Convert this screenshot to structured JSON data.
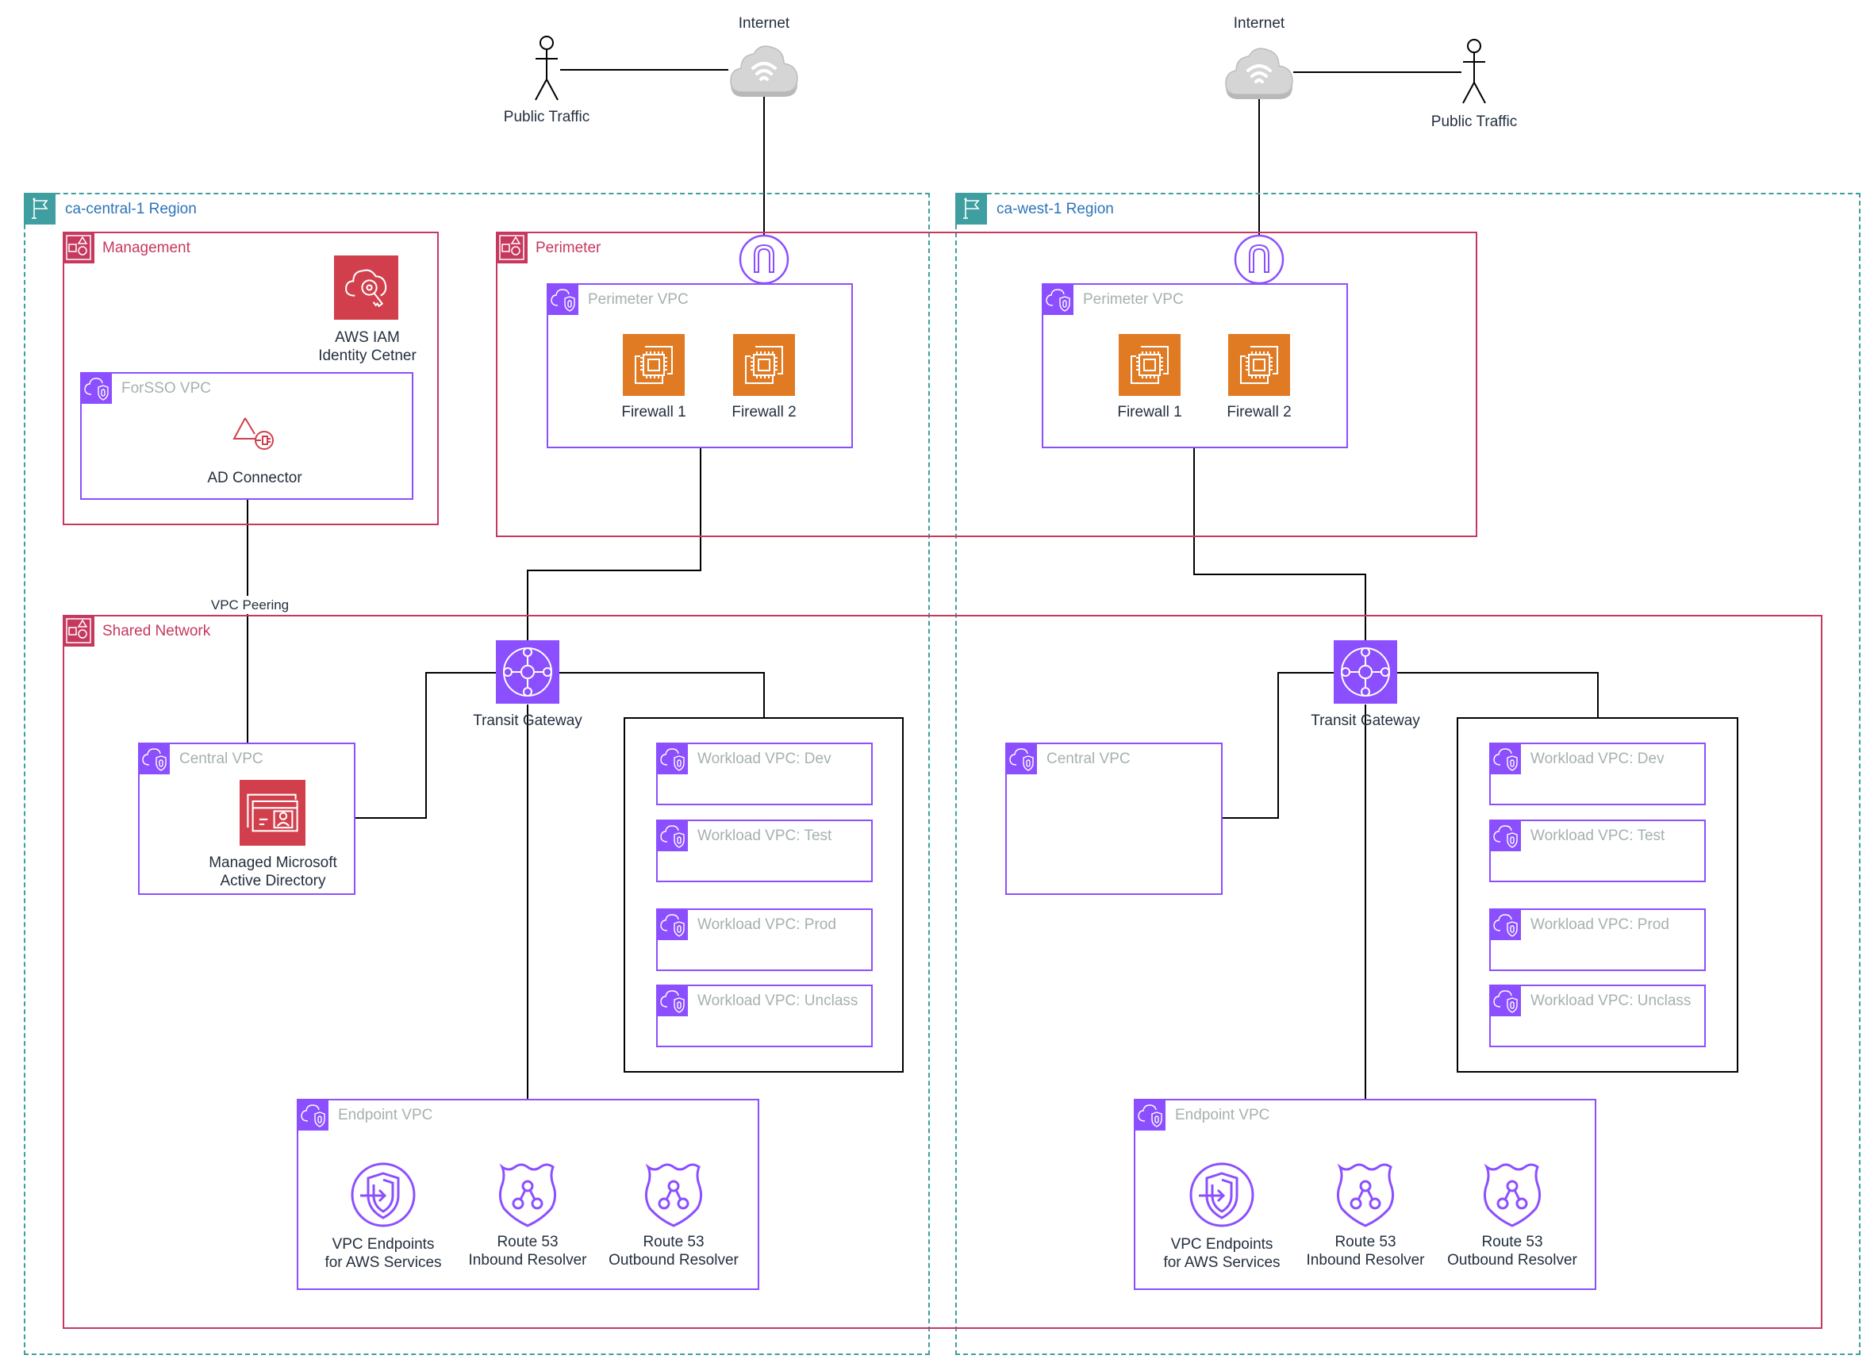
{
  "internet": [
    {
      "label": "Internet",
      "public_label": "Public Traffic"
    },
    {
      "label": "Internet",
      "public_label": "Public Traffic"
    }
  ],
  "regions": [
    {
      "label": "ca-central-1 Region",
      "management": {
        "label": "Management",
        "iam": {
          "line1": "AWS IAM",
          "line2": "Identity Cetner"
        },
        "forsso_vpc": {
          "label": "ForSSO VPC",
          "ad_connector": "AD Connector"
        }
      },
      "perimeter": {
        "label": "Perimeter",
        "vpc_label": "Perimeter VPC",
        "firewalls": [
          "Firewall 1",
          "Firewall 2"
        ]
      },
      "vpc_peering": "VPC Peering",
      "shared_network": {
        "label": "Shared Network",
        "tgw": "Transit Gateway",
        "central_vpc": {
          "label": "Central VPC",
          "mad": {
            "line1": "Managed Microsoft",
            "line2": "Active Directory"
          }
        },
        "workload_vpcs": [
          "Workload VPC: Dev",
          "Workload VPC: Test",
          "Workload VPC: Prod",
          "Workload VPC: Unclass"
        ],
        "endpoint_vpc": {
          "label": "Endpoint VPC",
          "services": [
            {
              "line1": "VPC Endpoints",
              "line2": "for AWS Services",
              "icon": "vpc-endpoints-icon"
            },
            {
              "line1": "Route 53",
              "line2": "Inbound Resolver",
              "icon": "route53-resolver-icon"
            },
            {
              "line1": "Route 53",
              "line2": "Outbound Resolver",
              "icon": "route53-resolver-icon"
            }
          ]
        }
      }
    },
    {
      "label": "ca-west-1 Region",
      "perimeter": {
        "vpc_label": "Perimeter VPC",
        "firewalls": [
          "Firewall 1",
          "Firewall 2"
        ]
      },
      "shared_network": {
        "tgw": "Transit Gateway",
        "central_vpc": {
          "label": "Central VPC"
        },
        "workload_vpcs": [
          "Workload VPC: Dev",
          "Workload VPC: Test",
          "Workload VPC: Prod",
          "Workload VPC: Unclass"
        ],
        "endpoint_vpc": {
          "label": "Endpoint VPC",
          "services": [
            {
              "line1": "VPC Endpoints",
              "line2": "for AWS Services",
              "icon": "vpc-endpoints-icon"
            },
            {
              "line1": "Route 53",
              "line2": "Inbound Resolver",
              "icon": "route53-resolver-icon"
            },
            {
              "line1": "Route 53",
              "line2": "Outbound Resolver",
              "icon": "route53-resolver-icon"
            }
          ]
        }
      }
    }
  ],
  "colors": {
    "region": "#3f9ea0",
    "region_text": "#2d74b8",
    "account": "#c7385f",
    "vpc": "#8c4fff",
    "vpc_text": "#a6b0b0",
    "compute": "#e07b24",
    "security": "#d13f4c"
  }
}
